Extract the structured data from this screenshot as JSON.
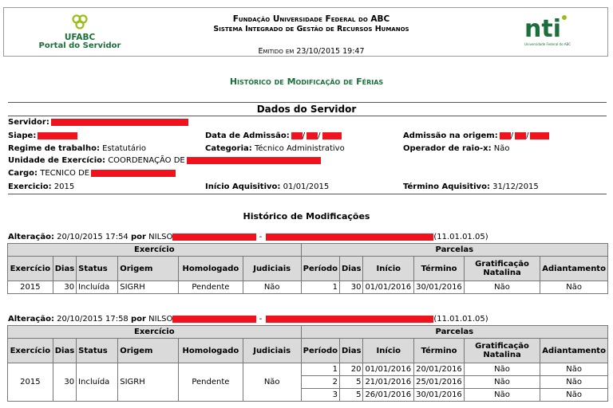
{
  "header": {
    "left_logo_name": "UFABC",
    "left_logo_sub": "Portal do Servidor",
    "title": "Fundação Universidade Federal do ABC",
    "subtitle": "Sistema Integrado de Gestão de Recursos Humanos",
    "issued": "Emitido em 23/10/2015 19:47",
    "right_logo_name": "nti",
    "right_logo_sub": "Universidade Federal do ABC"
  },
  "page_title": "Histórico de Modificação de Férias",
  "dados": {
    "title": "Dados do Servidor",
    "servidor_label": "Servidor:",
    "siape_label": "Siape:",
    "data_admissao_label": "Data de Admissão:",
    "admissao_origem_label": "Admissão na origem:",
    "regime_label": "Regime de trabalho:",
    "regime_value": "Estatutário",
    "categoria_label": "Categoria:",
    "categoria_value": "Técnico Administrativo",
    "raio_label": "Operador de raio-x:",
    "raio_value": "Não",
    "unidade_label": "Unidade de Exercício:",
    "unidade_value": "COORDENAÇÃO DE",
    "cargo_label": "Cargo:",
    "cargo_value": "TECNICO DE",
    "exercicio_label": "Exercicio:",
    "exercicio_value": "2015",
    "inicio_label": "Início Aquisitivo:",
    "inicio_value": "01/01/2015",
    "termino_label": "Término Aquisitivo:",
    "termino_value": "31/12/2015"
  },
  "historico_title": "Histórico de Modificações",
  "alteracoes": [
    {
      "label": "Alteração:",
      "datetime": "20/10/2015 17:54",
      "por": "por",
      "user": "NILSO",
      "sep": "-",
      "code": "(11.01.01.05)",
      "group_exercicio": "Exercício",
      "group_parcelas": "Parcelas",
      "headers": [
        "Exercício",
        "Dias",
        "Status",
        "Origem",
        "Homologado",
        "Judiciais",
        "Período",
        "Dias",
        "Início",
        "Término",
        "Gratificação Natalina",
        "Adiantamento"
      ],
      "exercicio": {
        "ano": "2015",
        "dias": "30",
        "status": "Incluída",
        "origem": "SIGRH",
        "homologado": "Pendente",
        "judiciais": "Não"
      },
      "parcelas": [
        {
          "periodo": "1",
          "dias": "30",
          "inicio": "01/01/2016",
          "termino": "30/01/2016",
          "gratificacao": "Não",
          "adiantamento": "Não"
        }
      ]
    },
    {
      "label": "Alteração:",
      "datetime": "20/10/2015 17:58",
      "por": "por",
      "user": "NILSO",
      "sep": "-",
      "code": "(11.01.01.05)",
      "group_exercicio": "Exercício",
      "group_parcelas": "Parcelas",
      "headers": [
        "Exercício",
        "Dias",
        "Status",
        "Origem",
        "Homologado",
        "Judiciais",
        "Período",
        "Dias",
        "Início",
        "Término",
        "Gratificação Natalina",
        "Adiantamento"
      ],
      "exercicio": {
        "ano": "2015",
        "dias": "30",
        "status": "Incluída",
        "origem": "SIGRH",
        "homologado": "Pendente",
        "judiciais": "Não"
      },
      "parcelas": [
        {
          "periodo": "1",
          "dias": "20",
          "inicio": "01/01/2016",
          "termino": "20/01/2016",
          "gratificacao": "Não",
          "adiantamento": "Não"
        },
        {
          "periodo": "2",
          "dias": "5",
          "inicio": "21/01/2016",
          "termino": "25/01/2016",
          "gratificacao": "Não",
          "adiantamento": "Não"
        },
        {
          "periodo": "3",
          "dias": "5",
          "inicio": "26/01/2016",
          "termino": "30/01/2016",
          "gratificacao": "Não",
          "adiantamento": "Não"
        }
      ]
    }
  ],
  "colors": {
    "brand_green": "#1b6f3a",
    "redaction": "#f0121d",
    "header_bg": "#dadada"
  }
}
